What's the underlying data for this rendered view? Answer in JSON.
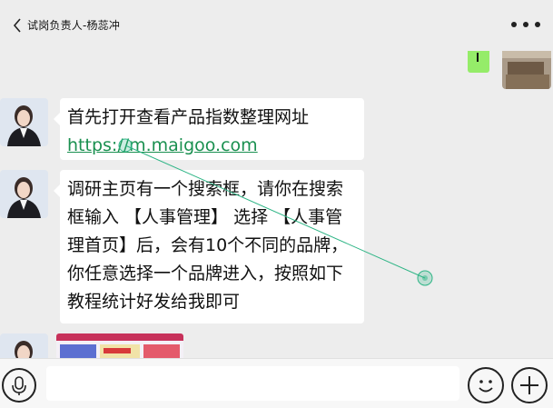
{
  "header": {
    "title": "试岗负责人-杨蕊冲",
    "back_icon": "chevron-left-icon",
    "more_icon": "more-dots-icon"
  },
  "own_message": {
    "text": "",
    "bubble_color": "#95ec69"
  },
  "messages": [
    {
      "type": "text",
      "line1": "首先打开查看产品指数整理网址",
      "link": "https://m.maigoo.com"
    },
    {
      "type": "text",
      "text": "调研主页有一个搜索框，请你在搜索框输入 【人事管理】 选择 【人事管理首页】后，会有10个不同的品牌，你任意选择一个品牌进入，按照如下教程统计好发给我即可"
    },
    {
      "type": "image"
    }
  ],
  "input_bar": {
    "value": "",
    "placeholder": "",
    "voice_icon": "microphone-icon",
    "emoji_icon": "emoji-icon",
    "plus_icon": "plus-icon"
  },
  "colors": {
    "background": "#ededed",
    "bubble": "#ffffff",
    "link": "#1a9050",
    "own_bubble": "#95ec69"
  }
}
